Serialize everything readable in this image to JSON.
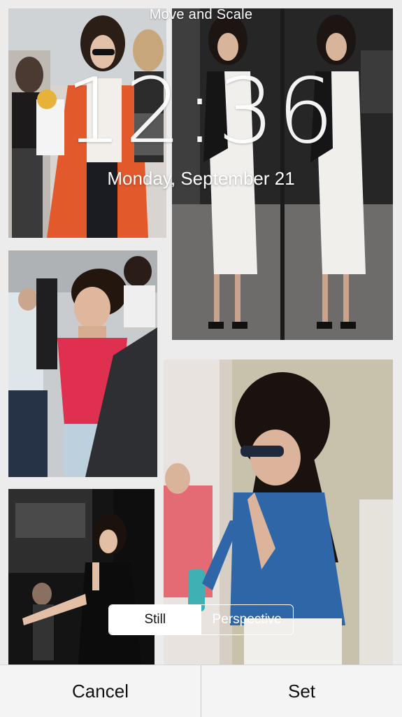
{
  "header": {
    "title": "Move and Scale"
  },
  "lockscreen": {
    "time": "12:36",
    "date": "Monday, September 21"
  },
  "mode_toggle": {
    "options": [
      {
        "label": "Still",
        "selected": true
      },
      {
        "label": "Perspective",
        "selected": false
      }
    ]
  },
  "actions": {
    "cancel_label": "Cancel",
    "set_label": "Set"
  },
  "colors": {
    "accent_text": "#111111",
    "bar_bg": "#f4f4f4",
    "overlay_text": "#ffffff"
  }
}
